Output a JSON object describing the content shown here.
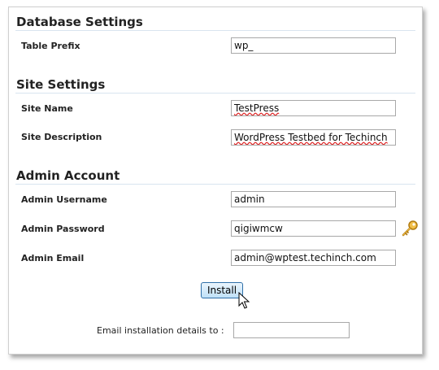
{
  "database_settings": {
    "title": "Database Settings",
    "table_prefix_label": "Table Prefix",
    "table_prefix_value": "wp_"
  },
  "site_settings": {
    "title": "Site Settings",
    "site_name_label": "Site Name",
    "site_name_value": "TestPress",
    "site_description_label": "Site Description",
    "site_description_value": "WordPress Testbed for Techinch"
  },
  "admin_account": {
    "title": "Admin Account",
    "username_label": "Admin Username",
    "username_value": "admin",
    "password_label": "Admin Password",
    "password_value": "qigiwmcw",
    "email_label": "Admin Email",
    "email_value": "admin@wptest.techinch.com"
  },
  "install_button": "Install",
  "email_details_label": "Email installation details to :",
  "email_details_value": "",
  "icons": {
    "password_generator": "key-icon",
    "pointer": "mouse-cursor-icon"
  },
  "colors": {
    "button_border": "#2f6fa8",
    "button_fill": "#bfe0f7",
    "key": "#e0a020"
  }
}
